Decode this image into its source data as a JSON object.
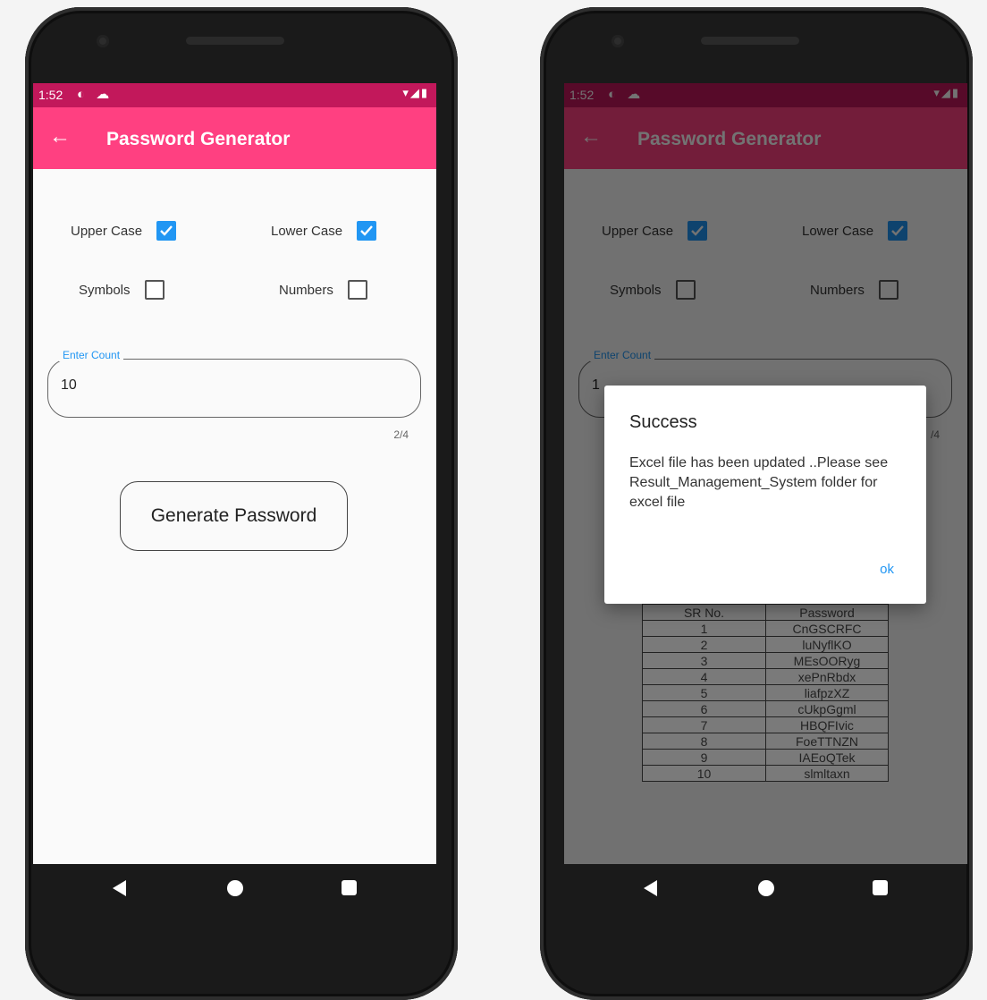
{
  "status_bar": {
    "time": "1:52",
    "left_icons": "◐ ☁",
    "right_icons": "▾◢▮"
  },
  "app_bar": {
    "back_icon": "back-arrow-icon",
    "title": "Password Generator"
  },
  "options": {
    "upper_case": {
      "label": "Upper Case",
      "checked": true
    },
    "lower_case": {
      "label": "Lower Case",
      "checked": true
    },
    "symbols": {
      "label": "Symbols",
      "checked": false
    },
    "numbers": {
      "label": "Numbers",
      "checked": false
    }
  },
  "count_field": {
    "label": "Enter Count",
    "value": "10",
    "value_partial": "1",
    "counter": "2/4",
    "counter_partial": "/4"
  },
  "generate_button": {
    "label": "Generate Password"
  },
  "dialog": {
    "title": "Success",
    "message": "Excel file has been updated ..Please see Result_Management_System folder for excel file",
    "ok_label": "ok"
  },
  "table": {
    "headers": [
      "SR No.",
      "Password"
    ],
    "rows": [
      [
        "1",
        "CnGSCRFC"
      ],
      [
        "2",
        "luNyflKO"
      ],
      [
        "3",
        "MEsOORyg"
      ],
      [
        "4",
        "xePnRbdx"
      ],
      [
        "5",
        "liafpzXZ"
      ],
      [
        "6",
        "cUkpGgml"
      ],
      [
        "7",
        "HBQFIvic"
      ],
      [
        "8",
        "FoeTTNZN"
      ],
      [
        "9",
        "IAEoQTek"
      ],
      [
        "10",
        "slmltaxn"
      ]
    ]
  },
  "colors": {
    "status_bar": "#c2185b",
    "app_bar": "#ff4081",
    "checkbox_checked": "#2196f3",
    "accent_text": "#2196f3"
  },
  "nav_icons": [
    "nav-back-icon",
    "nav-home-icon",
    "nav-recents-icon"
  ]
}
